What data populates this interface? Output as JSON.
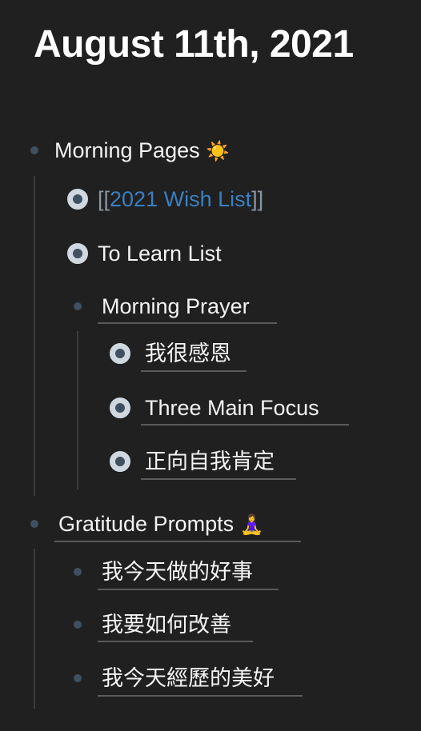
{
  "page": {
    "title": "August 11th, 2021"
  },
  "blocks": {
    "morning_pages": {
      "text": "Morning Pages",
      "emoji": "☀️"
    },
    "wish_list": {
      "open": "[[",
      "link": "2021 Wish List",
      "close": "]]"
    },
    "to_learn": {
      "text": "To Learn List"
    },
    "morning_prayer": {
      "text": "Morning Prayer"
    },
    "grateful": {
      "text": "我很感恩"
    },
    "three_focus": {
      "text": "Three Main Focus"
    },
    "affirmation": {
      "text": "正向自我肯定"
    },
    "gratitude_prompts": {
      "text": "Gratitude Prompts",
      "emoji": "🧘‍♀️"
    },
    "good_deeds": {
      "text": "我今天做的好事"
    },
    "improve": {
      "text": "我要如何改善"
    },
    "beautiful": {
      "text": "我今天經歷的美好"
    }
  },
  "colors": {
    "background": "#202020",
    "link": "#3b7fc0",
    "bullet": "#3f5060"
  }
}
